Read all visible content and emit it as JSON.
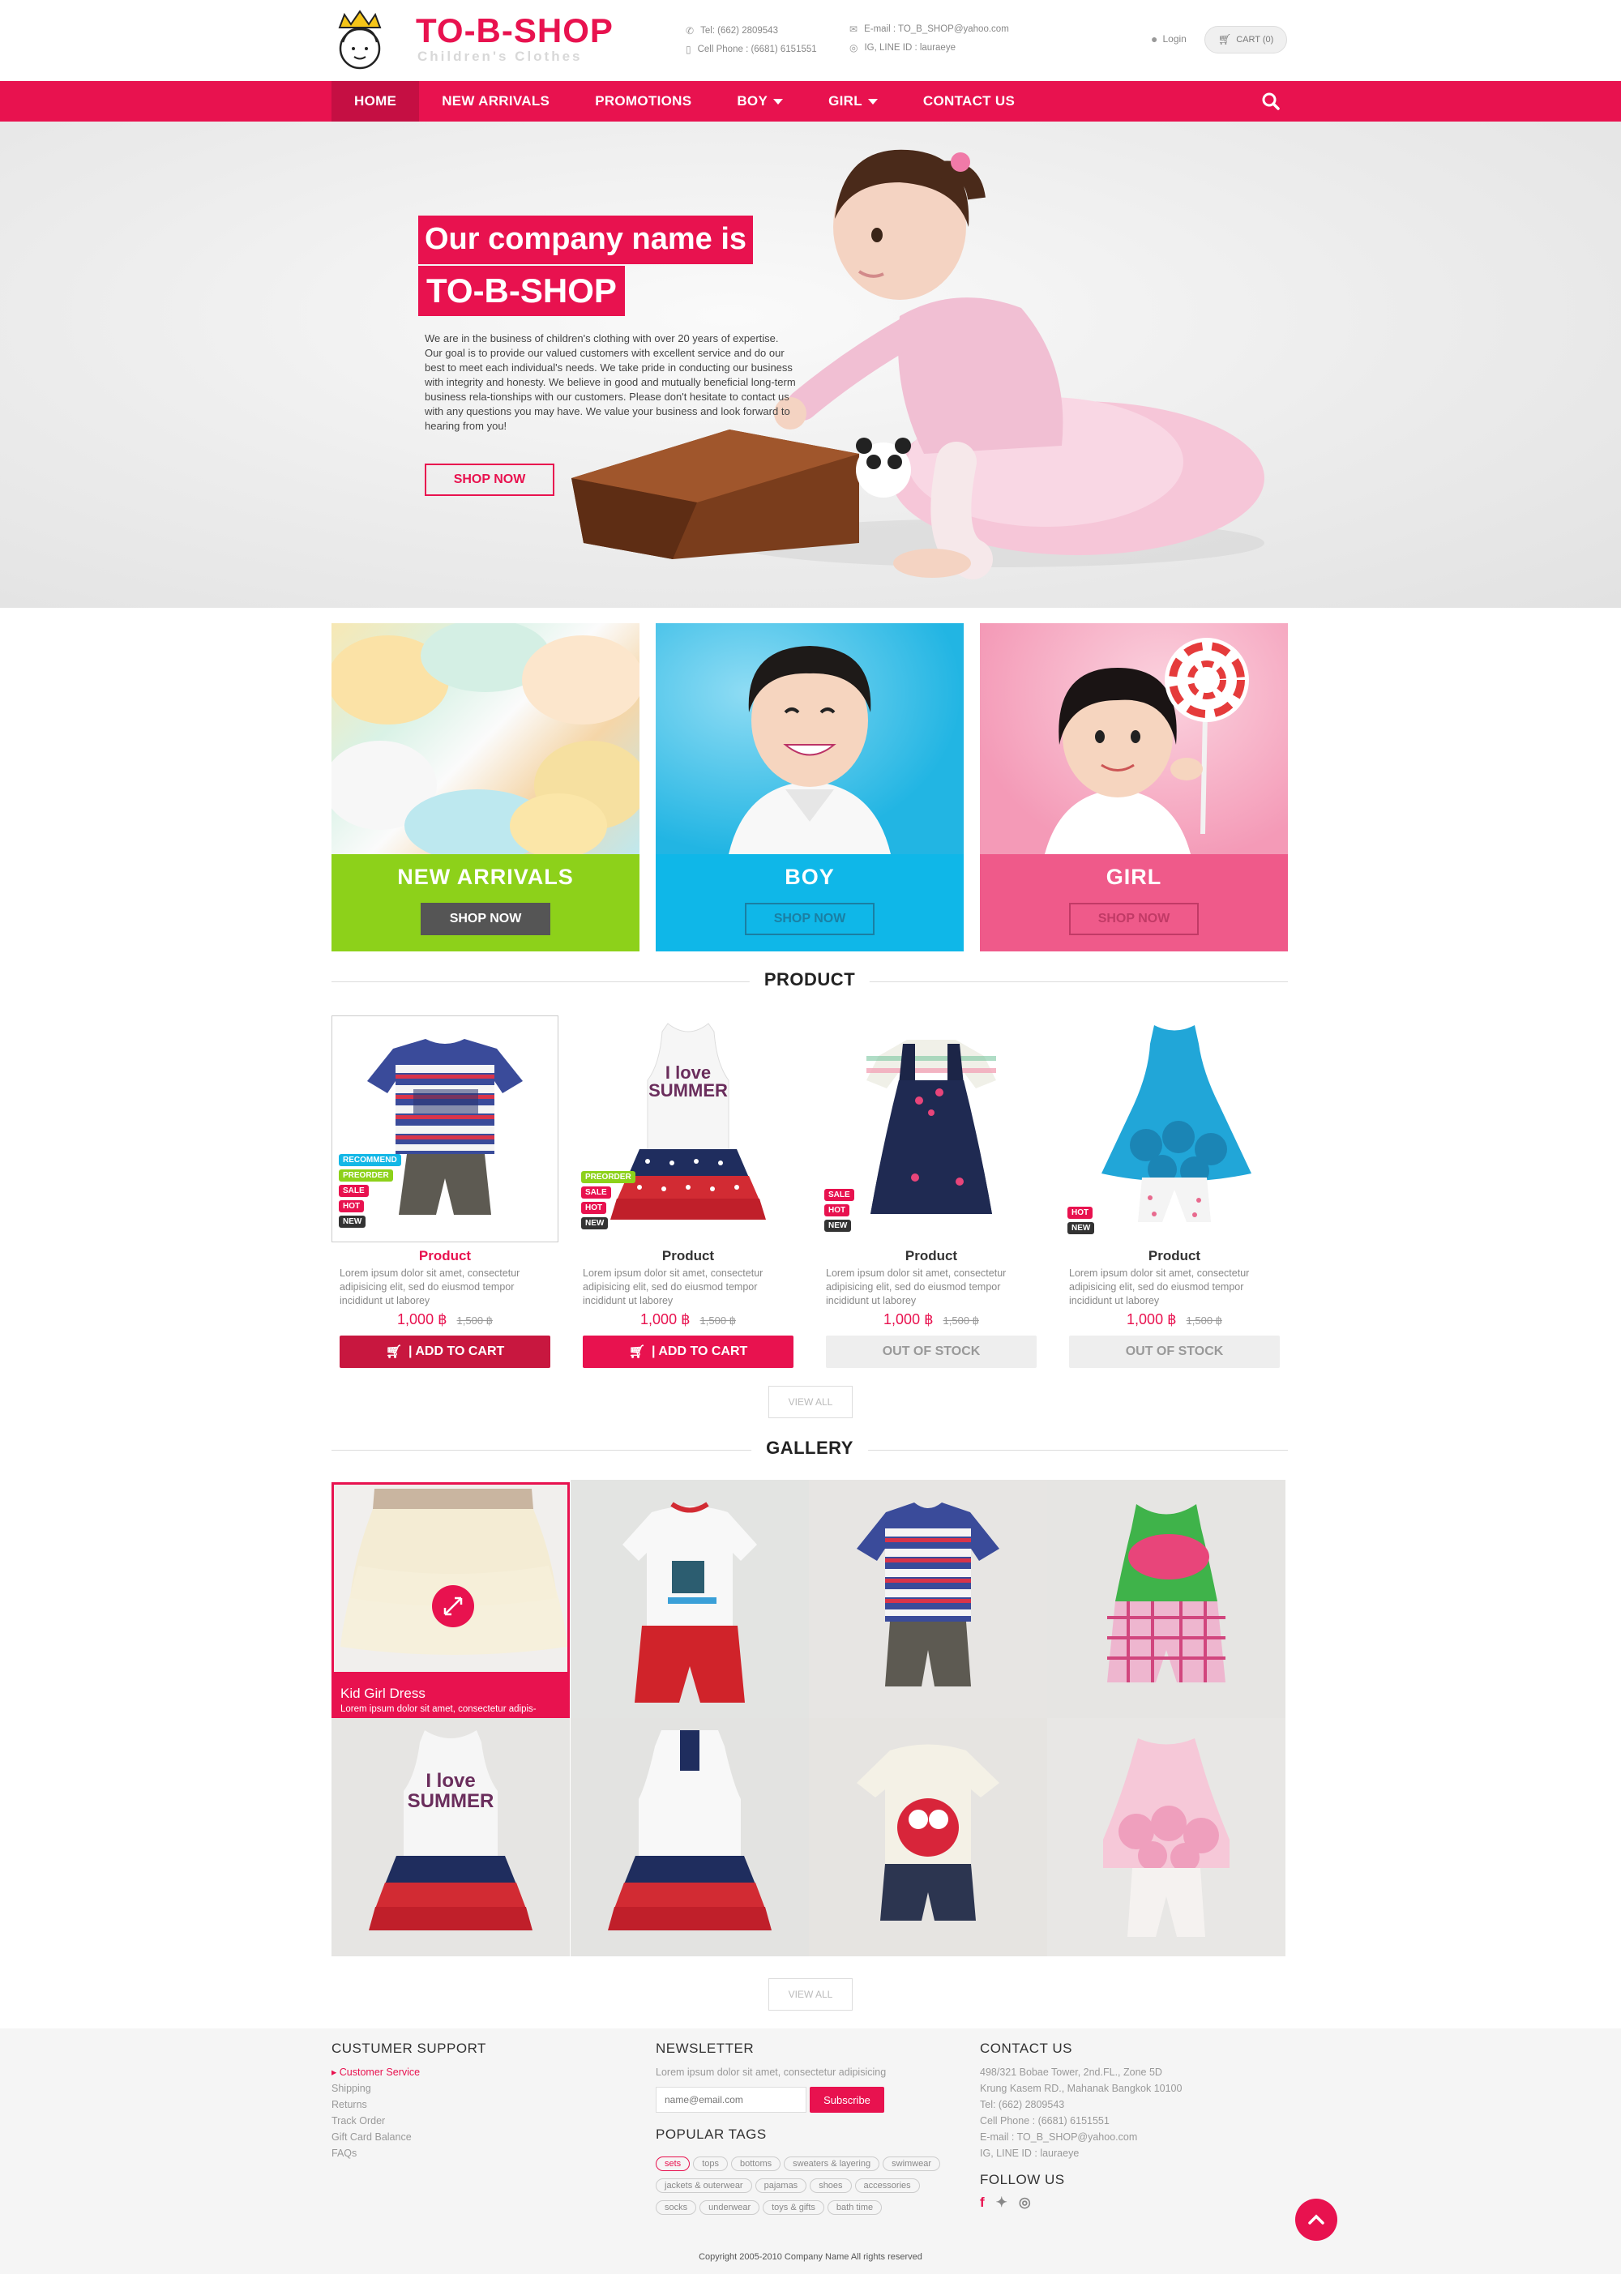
{
  "header": {
    "brand": "TO-B-SHOP",
    "tagline": "Children's Clothes",
    "tel": "Tel: (662) 2809543",
    "cell": "Cell Phone : (6681) 6151551",
    "email": "E-mail : TO_B_SHOP@yahoo.com",
    "ig_line": "IG, LINE ID : lauraeye",
    "login": "Login",
    "cart": "CART (0)"
  },
  "nav": {
    "items": [
      "HOME",
      "NEW ARRIVALS",
      "PROMOTIONS",
      "BOY",
      "GIRL",
      "CONTACT US"
    ]
  },
  "hero": {
    "title_line1": "Our  company name is",
    "title_line2": "TO-B-SHOP",
    "text": "We are in the business of children's clothing with over 20 years of expertise. Our goal is to provide our valued customers with excellent service and do our best to meet each individual's needs. We take pride in conducting our business with integrity and honesty. We believe in good and mutually beneficial long-term business rela-tionships with our customers. Please don't hesitate to contact us with any questions you may have. We value your business and look forward to hearing from you!",
    "button": "SHOP NOW"
  },
  "categories": [
    {
      "title": "NEW ARRIVALS",
      "button": "SHOP NOW",
      "color": "#8dd11a"
    },
    {
      "title": "BOY",
      "button": "SHOP NOW",
      "color": "#0fb7e8"
    },
    {
      "title": "GIRL",
      "button": "SHOP NOW",
      "color": "#ef5a8a"
    }
  ],
  "product_section": {
    "title": "PRODUCT",
    "view_all": "VIEW ALL"
  },
  "products": [
    {
      "name": "Product",
      "desc": "Lorem ipsum dolor sit amet, consectetur adipisicing elit, sed do eiusmod tempor incididunt ut laborey",
      "price": "1,000 ฿",
      "old_price": "1,500 ฿",
      "button": "|  ADD TO CART",
      "badges": [
        "RECOMMEND",
        "PREORDER",
        "SALE",
        "HOT",
        "NEW"
      ]
    },
    {
      "name": "Product",
      "desc": "Lorem ipsum dolor sit amet, consectetur adipisicing elit, sed do eiusmod tempor incididunt ut laborey",
      "price": "1,000 ฿",
      "old_price": "1,500 ฿",
      "button": "|  ADD TO CART",
      "badges": [
        "PREORDER",
        "SALE",
        "HOT",
        "NEW"
      ]
    },
    {
      "name": "Product",
      "desc": "Lorem ipsum dolor sit amet, consectetur adipisicing elit, sed do eiusmod tempor incididunt ut laborey",
      "price": "1,000 ฿",
      "old_price": "1,500 ฿",
      "button": "OUT OF STOCK",
      "badges": [
        "SALE",
        "HOT",
        "NEW"
      ]
    },
    {
      "name": "Product",
      "desc": "Lorem ipsum dolor sit amet, consectetur adipisicing elit, sed do eiusmod tempor incididunt ut laborey",
      "price": "1,000 ฿",
      "old_price": "1,500 ฿",
      "button": "OUT OF STOCK",
      "badges": [
        "HOT",
        "NEW"
      ]
    }
  ],
  "badge_colors": {
    "RECOMMEND": "#13b7e6",
    "PREORDER": "#8dd11a",
    "SALE": "#e8124f",
    "HOT": "#e8124f",
    "NEW": "#333333"
  },
  "gallery_section": {
    "title": "GALLERY",
    "view_all": "VIEW ALL",
    "caption_title": "Kid Girl Dress",
    "caption_text": "Lorem ipsum dolor sit amet, consectetur adipis-"
  },
  "footer": {
    "support_title": "CUSTUMER SUPPORT",
    "support_links": [
      "Customer Service",
      "Shipping",
      "Returns",
      "Track Order",
      "Gift Card Balance",
      "FAQs"
    ],
    "newsletter_title": "NEWSLETTER",
    "newsletter_text": "Lorem ipsum dolor sit amet, consectetur adipisicing",
    "email_placeholder": "name@email.com",
    "subscribe": "Subscribe",
    "tags_title": "POPULAR TAGS",
    "tags": [
      "sets",
      "tops",
      "bottoms",
      "sweaters & layering",
      "swimwear",
      "jackets & outerwear",
      "pajamas",
      "shoes",
      "accessories",
      "socks",
      "underwear",
      "toys & gifts",
      "bath time"
    ],
    "contact_title": "CONTACT US",
    "contact_lines": [
      "498/321 Bobae Tower, 2nd.FL., Zone 5D",
      "Krung Kasem RD., Mahanak Bangkok 10100",
      "Tel: (662) 2809543",
      "Cell Phone : (6681) 6151551",
      "E-mail : TO_B_SHOP@yahoo.com",
      "IG, LINE ID : lauraeye"
    ],
    "follow_title": "FOLLOW US",
    "copyright": "Copyright  2005-2010 Company Name All rights reserved"
  },
  "colors": {
    "accent": "#e8124f",
    "nav_active": "#c50f43",
    "footer_bg": "#f5f5f5"
  }
}
